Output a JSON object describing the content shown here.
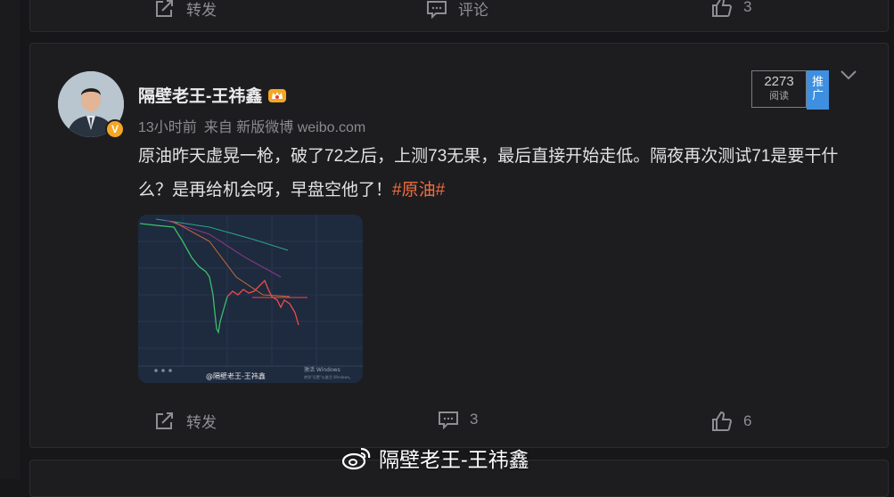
{
  "prev_post": {
    "repost_label": "转发",
    "comment_label": "评论",
    "like_count": "3"
  },
  "post": {
    "author": "隔壁老王-王祎鑫",
    "time": "13小时前",
    "source": "来自 新版微博 weibo.com",
    "text": "原油昨天虚晃一枪，破了72之后，上测73无果，最后直接开始走低。隔夜再次测试71是要干什么？是再给机会呀，早盘空他了！",
    "hashtag": "#原油#",
    "read_count": "2273",
    "read_label": "阅读",
    "promo_label": "推广",
    "image": {
      "watermark": "@隔壁老王-王祎鑫",
      "windows_notice": "激活 Windows",
      "windows_notice_sub": "转到\"设置\"以激活 Windows。"
    },
    "actions": {
      "repost_label": "转发",
      "comment_count": "3",
      "like_count": "6"
    }
  },
  "page_watermark": "隔壁老王-王祎鑫",
  "colors": {
    "background": "#17171a",
    "card": "#1d1d20",
    "hashtag": "#f26d3d",
    "promo": "#3f8fe0",
    "verified_badge": "#f5a623"
  }
}
